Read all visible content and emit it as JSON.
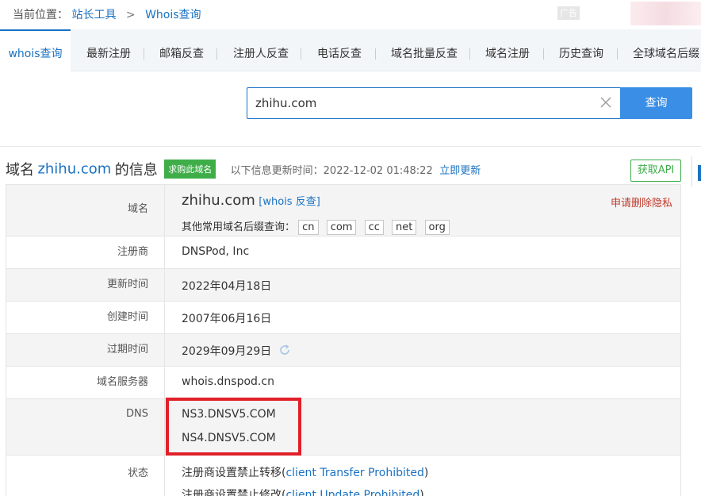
{
  "breadcrumb": {
    "prefix": "当前位置：",
    "home": "站长工具",
    "sep": ">",
    "current": "Whois查询"
  },
  "ad_label": "广告",
  "tabs": [
    {
      "label": "whois查询",
      "active": true
    },
    {
      "label": "最新注册"
    },
    {
      "label": "邮箱反查"
    },
    {
      "label": "注册人反查"
    },
    {
      "label": "电话反查"
    },
    {
      "label": "域名批量反查"
    },
    {
      "label": "域名注册"
    },
    {
      "label": "历史查询"
    },
    {
      "label": "全球域名后缀"
    }
  ],
  "search": {
    "value": "zhihu.com",
    "button": "查询"
  },
  "info_header": {
    "title_pre": "域名",
    "domain": "zhihu.com",
    "title_post": "的信息",
    "buy_badge": "求购此域名",
    "updated_label": "以下信息更新时间：2022-12-02 01:48:22",
    "update_now": "立即更新",
    "api_button": "获取API"
  },
  "rows": {
    "domain": {
      "label": "域名",
      "value": "zhihu.com",
      "whois_link": "[whois 反查]",
      "privacy": "申请删除隐私",
      "suffix_label": "其他常用域名后缀查询：",
      "suffixes": [
        "cn",
        "com",
        "cc",
        "net",
        "org"
      ]
    },
    "registrar": {
      "label": "注册商",
      "value": "DNSPod, Inc"
    },
    "updated": {
      "label": "更新时间",
      "value": "2022年04月18日"
    },
    "created": {
      "label": "创建时间",
      "value": "2007年06月16日"
    },
    "expires": {
      "label": "过期时间",
      "value": "2029年09月29日"
    },
    "whois_server": {
      "label": "域名服务器",
      "value": "whois.dnspod.cn"
    },
    "dns": {
      "label": "DNS",
      "values": [
        "NS3.DNSV5.COM",
        "NS4.DNSV5.COM"
      ]
    },
    "status": {
      "label": "状态",
      "items": [
        {
          "text": "注册商设置禁止转移(",
          "link": "client Transfer Prohibited",
          "close": ")"
        },
        {
          "text": "注册商设置禁止修改(",
          "link": "client Update Prohibited",
          "close": ")"
        }
      ]
    }
  },
  "colors": {
    "link": "#1a72c2",
    "button": "#3a8ee6",
    "badge": "#3fae49",
    "highlight": "#e02029",
    "privacy": "#c0392b"
  }
}
